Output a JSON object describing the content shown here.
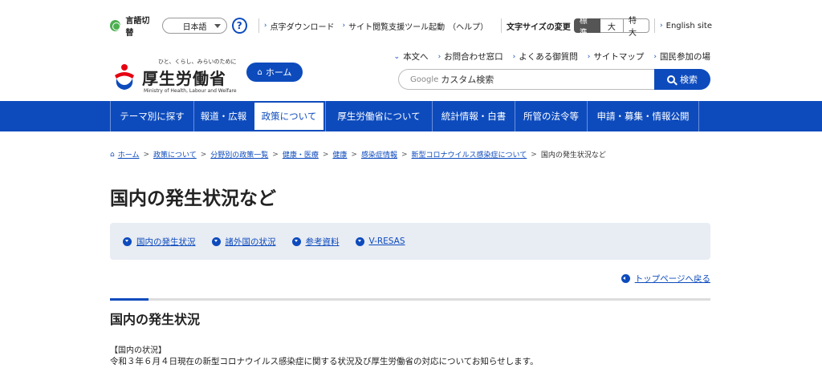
{
  "utility": {
    "lang_label": "言語切替",
    "lang_value": "日本語",
    "help": "?",
    "links": [
      "点字ダウンロード",
      "サイト閲覧支援ツール起動",
      "（ヘルプ）"
    ],
    "size_label": "文字サイズの変更",
    "sizes": [
      "標準",
      "大",
      "特大"
    ],
    "english": "English site"
  },
  "header": {
    "logo_tagline": "ひと、くらし、みらいのために",
    "logo_name": "厚生労働省",
    "logo_en": "Ministry of Health, Labour and Welfare",
    "home_button": "ホーム",
    "sub_links": [
      "本文へ",
      "お問合わせ窓口",
      "よくある御質問",
      "サイトマップ",
      "国民参加の場"
    ],
    "search_google": "Google",
    "search_placeholder": "カスタム検索",
    "search_button": "検索"
  },
  "nav": {
    "items": [
      "テーマ別に探す",
      "報道・広報",
      "政策について",
      "厚生労働省について",
      "統計情報・白書",
      "所管の法令等",
      "申請・募集・情報公開"
    ]
  },
  "breadcrumb": {
    "items": [
      "ホーム",
      "政策について",
      "分野別の政策一覧",
      "健康・医療",
      "健康",
      "感染症情報",
      "新型コロナウイルス感染症について"
    ],
    "current": "国内の発生状況など"
  },
  "page": {
    "title": "国内の発生状況など",
    "toc": [
      "国内の発生状況",
      "諸外国の状況",
      "参考資料",
      "V-RESAS"
    ],
    "back_to_top": "トップページへ戻る",
    "section_title": "国内の発生状況",
    "label": "【国内の状況】",
    "text": "令和３年６月４日現在の新型コロナウイルス感染症に関する状況及び厚生労働省の対応についてお知らせします。"
  },
  "colors": {
    "brand": "#0d4bbd",
    "toc_bg": "#e8ecf3"
  }
}
